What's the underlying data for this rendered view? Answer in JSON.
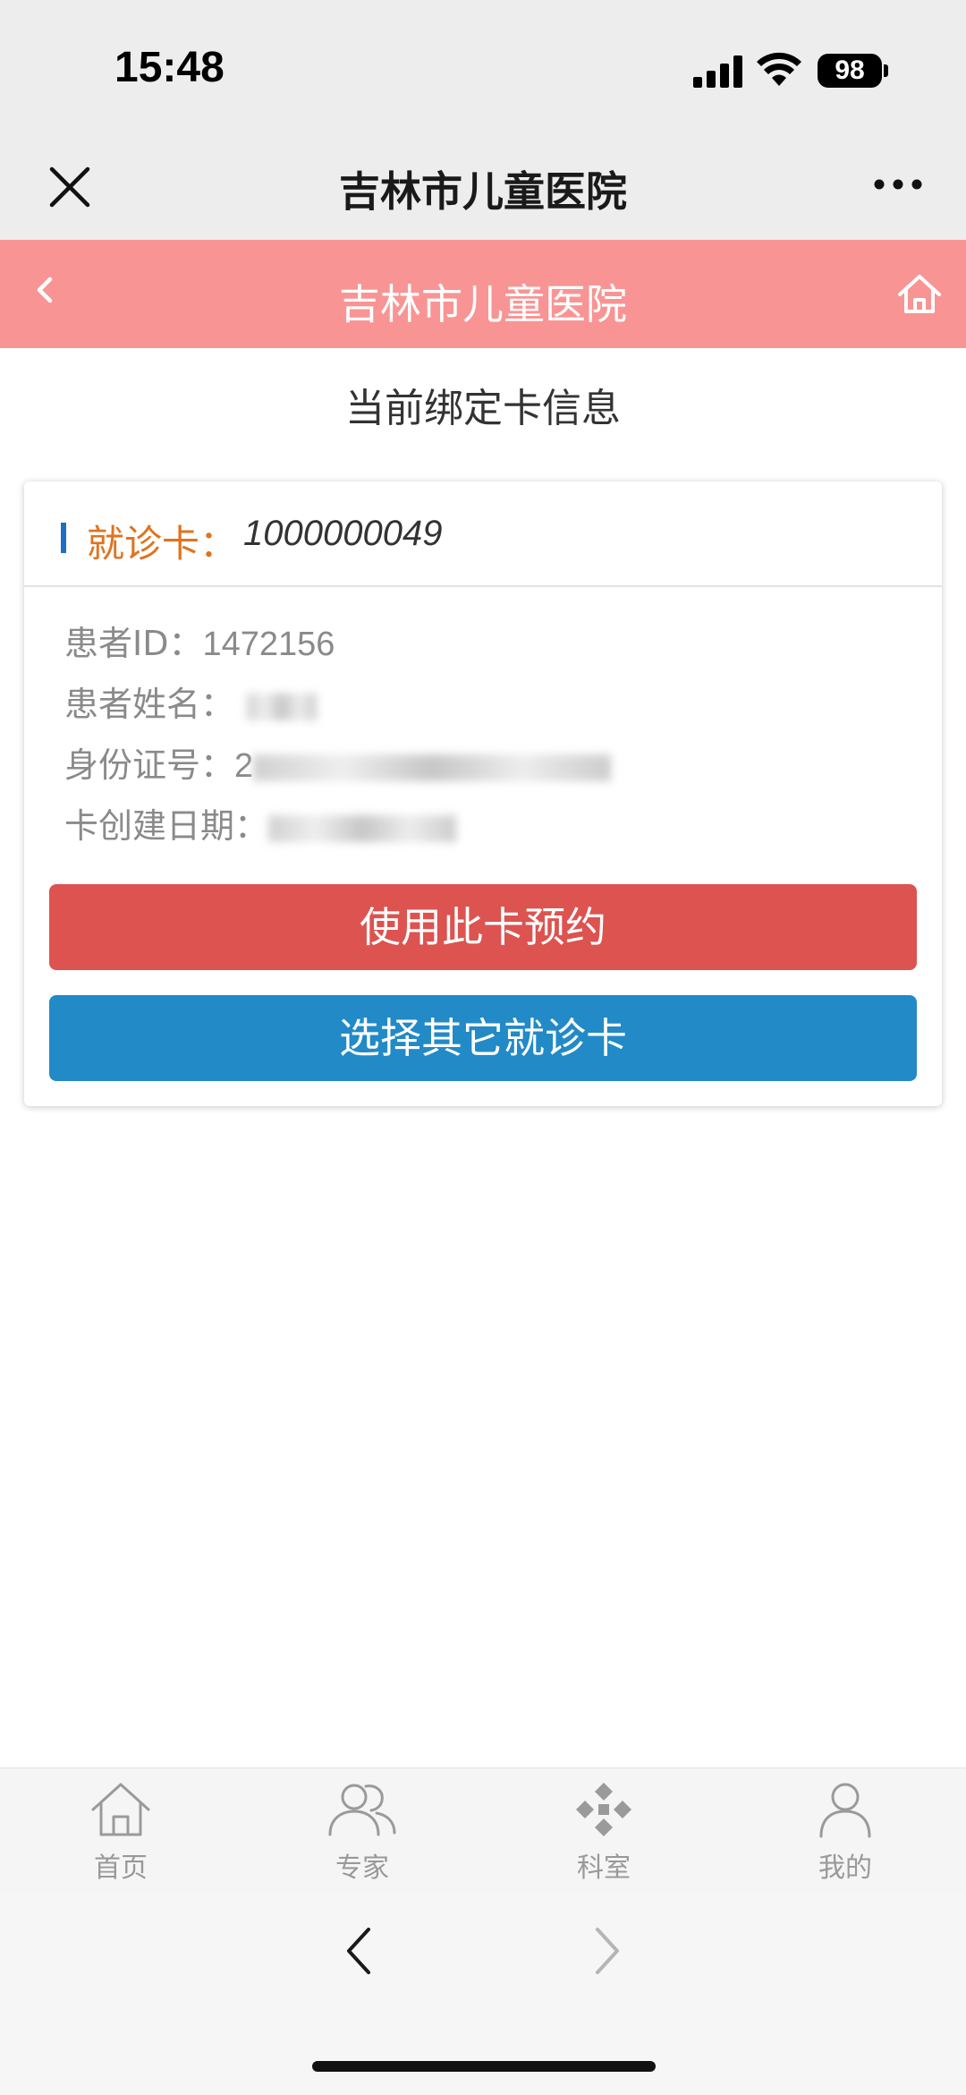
{
  "status_bar": {
    "time": "15:48",
    "battery": "98"
  },
  "wechat_nav": {
    "title": "吉林市儿童医院"
  },
  "header": {
    "title": "吉林市儿童医院"
  },
  "page": {
    "heading": "当前绑定卡信息"
  },
  "card": {
    "label": "就诊卡：",
    "number": "1000000049",
    "rows": [
      {
        "label": "患者ID：",
        "value": "1472156"
      },
      {
        "label": "患者姓名：",
        "value": ""
      },
      {
        "label": "身份证号：",
        "value": "2"
      },
      {
        "label": "卡创建日期：",
        "value": ""
      }
    ]
  },
  "buttons": {
    "use_card": "使用此卡预约",
    "choose_other": "选择其它就诊卡"
  },
  "tabbar": {
    "items": [
      {
        "label": "首页",
        "icon": "home-icon"
      },
      {
        "label": "专家",
        "icon": "experts-icon"
      },
      {
        "label": "科室",
        "icon": "department-icon"
      },
      {
        "label": "我的",
        "icon": "profile-icon"
      }
    ]
  },
  "colors": {
    "header_bg": "#f89594",
    "card_label": "#e0731f",
    "primary_button": "#dc5350",
    "secondary_button": "#218ac7",
    "accent_bar": "#1e6fc0"
  }
}
